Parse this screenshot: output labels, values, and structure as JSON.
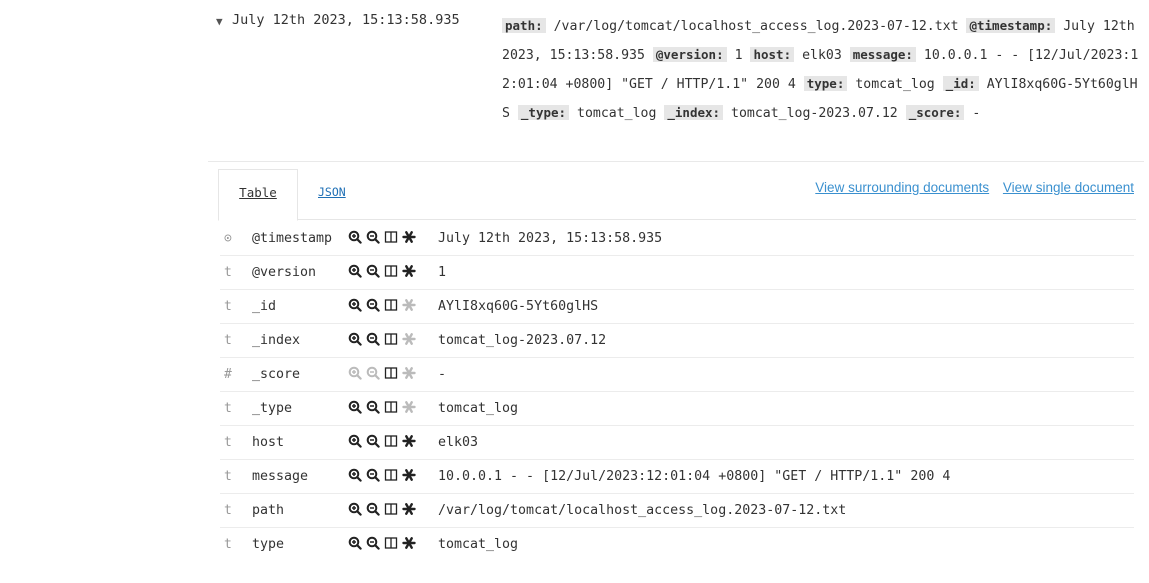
{
  "summary": {
    "time": "July 12th 2023, 15:13:58.935",
    "source": [
      {
        "key": "path:",
        "value": "/var/log/tomcat/localhost_access_log.2023-07-12.txt"
      },
      {
        "key": "@timestamp:",
        "value": "July 12th 2023, 15:13:58.935"
      },
      {
        "key": "@version:",
        "value": "1"
      },
      {
        "key": "host:",
        "value": "elk03"
      },
      {
        "key": "message:",
        "value": "10.0.0.1 - - [12/Jul/2023:12:01:04 +0800] \"GET / HTTP/1.1\" 200 4"
      },
      {
        "key": "type:",
        "value": "tomcat_log"
      },
      {
        "key": "_id:",
        "value": "AYlI8xq60G-5Yt60glHS"
      },
      {
        "key": "_type:",
        "value": "tomcat_log"
      },
      {
        "key": "_index:",
        "value": "tomcat_log-2023.07.12"
      },
      {
        "key": "_score:",
        "value": "-"
      }
    ]
  },
  "tabs": {
    "table": "Table",
    "json": "JSON"
  },
  "links": {
    "surrounding": "View surrounding documents",
    "single": "View single document"
  },
  "colors": {
    "link": "#3a90cf",
    "key_bg": "#e6e6e6",
    "icon": "#222222",
    "icon_muted": "#bbbbbb"
  },
  "fields": [
    {
      "type": "⊙",
      "name": "@timestamp",
      "value": "July 12th 2023, 15:13:58.935",
      "muted_filter": false,
      "muted_exists": false
    },
    {
      "type": "t",
      "name": "@version",
      "value": "1",
      "muted_filter": false,
      "muted_exists": false
    },
    {
      "type": "t",
      "name": "_id",
      "value": "AYlI8xq60G-5Yt60glHS",
      "muted_filter": false,
      "muted_exists": true
    },
    {
      "type": "t",
      "name": "_index",
      "value": "tomcat_log-2023.07.12",
      "muted_filter": false,
      "muted_exists": true
    },
    {
      "type": "#",
      "name": "_score",
      "value": "-",
      "muted_filter": true,
      "muted_exists": true
    },
    {
      "type": "t",
      "name": "_type",
      "value": "tomcat_log",
      "muted_filter": false,
      "muted_exists": true
    },
    {
      "type": "t",
      "name": "host",
      "value": "elk03",
      "muted_filter": false,
      "muted_exists": false
    },
    {
      "type": "t",
      "name": "message",
      "value": "10.0.0.1 - - [12/Jul/2023:12:01:04 +0800] \"GET / HTTP/1.1\" 200 4",
      "muted_filter": false,
      "muted_exists": false
    },
    {
      "type": "t",
      "name": "path",
      "value": "/var/log/tomcat/localhost_access_log.2023-07-12.txt",
      "muted_filter": false,
      "muted_exists": false
    },
    {
      "type": "t",
      "name": "type",
      "value": "tomcat_log",
      "muted_filter": false,
      "muted_exists": false
    }
  ]
}
